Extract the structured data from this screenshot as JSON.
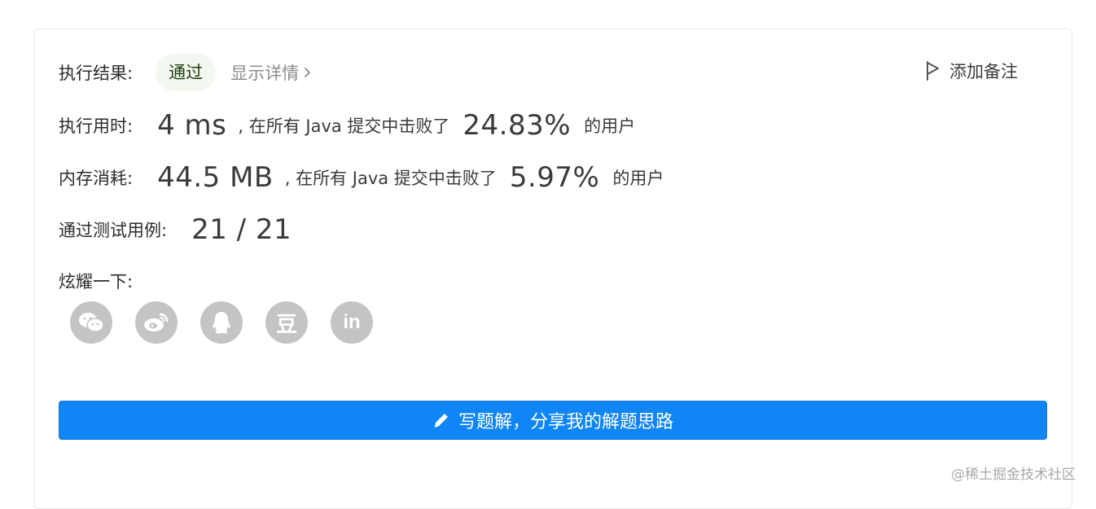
{
  "result": {
    "label": "执行结果:",
    "status": "通过",
    "details_link": "显示详情",
    "add_note": "添加备注"
  },
  "runtime": {
    "label": "执行用时:",
    "value": "4 ms",
    "middle": ", 在所有 Java 提交中击败了",
    "percent": "24.83%",
    "suffix": "的用户"
  },
  "memory": {
    "label": "内存消耗:",
    "value": "44.5 MB",
    "middle": ", 在所有 Java 提交中击败了",
    "percent": "5.97%",
    "suffix": "的用户"
  },
  "tests": {
    "label": "通过测试用例:",
    "value": "21 / 21"
  },
  "share": {
    "label": "炫耀一下:",
    "icons": [
      "wechat-icon",
      "weibo-icon",
      "qq-icon",
      "douban-icon",
      "linkedin-icon"
    ],
    "douban_glyph": "豆",
    "linkedin_glyph": "in"
  },
  "write_solution_button": "写题解，分享我的解题思路",
  "watermark": "@稀土掘金技术社区",
  "colors": {
    "primary": "#1086f6",
    "badge_bg": "#f2f8ef",
    "icon_bg": "#c4c4c4",
    "muted": "#8c8c8c"
  }
}
